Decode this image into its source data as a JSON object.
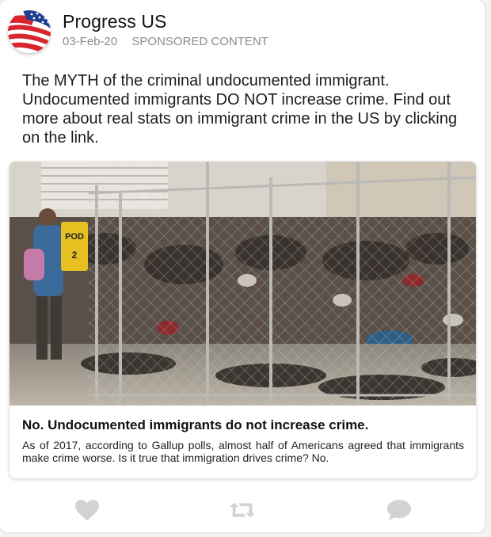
{
  "post": {
    "page_name": "Progress US",
    "date": "03-Feb-20",
    "tag": "SPONSORED CONTENT",
    "text": "The MYTH of the criminal undocumented immigrant. Undocumented immigrants DO NOT increase crime. Find out more about real stats on immigrant crime in the US by clicking on the link."
  },
  "link_card": {
    "photo_sign_line1": "POD",
    "photo_sign_line2": "2",
    "title": "No. Undocumented immigrants do not increase crime.",
    "description": "As of 2017, according to Gallup polls, almost half of Americans agreed that immigrants make crime worse. Is it true that immigration drives crime? No."
  },
  "actions": {
    "like_icon": "heart-icon",
    "share_icon": "retweet-icon",
    "comment_icon": "speech-bubble-icon"
  },
  "colors": {
    "flag_red": "#d8262c",
    "flag_blue": "#1f3f8f",
    "icon_gray": "#d2d2d2"
  }
}
